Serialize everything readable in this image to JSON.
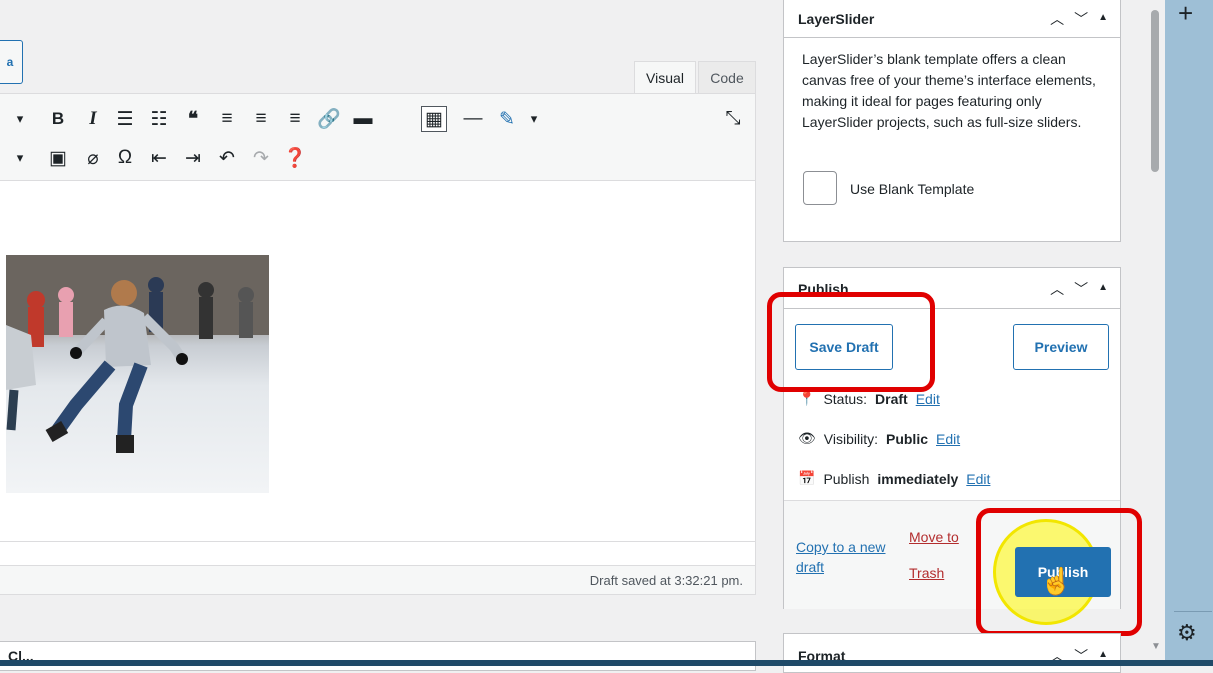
{
  "editor": {
    "media_button": "a",
    "tabs": {
      "visual": "Visual",
      "code": "Code"
    },
    "status": "Draft saved at 3:32:21 pm.",
    "bottom_box_title": "Cl..."
  },
  "layerslider": {
    "title": "LayerSlider",
    "description": "LayerSlider’s blank template offers a clean canvas free of your theme’s interface elements, making it ideal for pages featuring only LayerSlider projects, such as full-size sliders.",
    "checkbox_label": "Use Blank Template"
  },
  "publish": {
    "title": "Publish",
    "save_draft": "Save Draft",
    "preview": "Preview",
    "status_label": "Status:",
    "status_value": "Draft",
    "visibility_label": "Visibility:",
    "visibility_value": "Public",
    "schedule_label": "Publish",
    "schedule_value": "immediately",
    "edit": "Edit",
    "copy_draft": "Copy to a new draft",
    "move_trash_1": "Move to",
    "move_trash_2": "Trash",
    "publish_button": "Publish"
  },
  "format": {
    "title": "Format"
  },
  "colors": {
    "accent": "#2271b1",
    "annotation": "#e00000",
    "highlight": "#fff700",
    "trash": "#b32d2e"
  }
}
